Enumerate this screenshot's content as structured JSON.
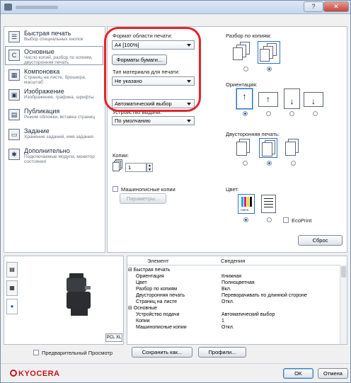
{
  "nav": {
    "items": [
      {
        "title": "Быстрая печать",
        "sub": "Выбор специальных кнопок",
        "icon": "quick-print-icon",
        "glyph": "☰"
      },
      {
        "title": "Основные",
        "sub": "Число копий, разбор по копиям, двусторонняя печать",
        "icon": "basic-icon",
        "glyph": "C"
      },
      {
        "title": "Компоновка",
        "sub": "Страниц на листе, брошюра, масштаб",
        "icon": "layout-icon",
        "glyph": "▦"
      },
      {
        "title": "Изображение",
        "sub": "Изображение, графика, шрифты",
        "icon": "image-icon",
        "glyph": "▣"
      },
      {
        "title": "Публикация",
        "sub": "Режим обложки, вставка страниц",
        "icon": "publishing-icon",
        "glyph": "▤"
      },
      {
        "title": "Задание",
        "sub": "Хранение заданий, имя задания",
        "icon": "job-icon",
        "glyph": "▭"
      },
      {
        "title": "Дополнительно",
        "sub": "Подключаемые модули, монитор состояния",
        "icon": "advanced-icon",
        "glyph": "✱"
      }
    ]
  },
  "basic": {
    "print_size_label": "Формат области печати:",
    "print_size_value": "A4 [100%]",
    "paper_sizes_button": "Форматы бумаги...",
    "media_type_label": "Тип материала для печати:",
    "media_type_value": "Не указано",
    "source_value": "Автоматический выбор",
    "output_label": "Устройство выдачи:",
    "output_value": "По умолчанию",
    "copies_label": "Копии:",
    "copies_value": "1",
    "mopy_label": "Машинописные копии",
    "settings_button": "Параметры...",
    "collate_label": "Разбор по копиям:",
    "orientation_label": "Ориентация:",
    "duplex_label": "Двусторонняя печать:",
    "color_label": "Цвет:",
    "ecoprint_label": "EcoPrint",
    "reset_button": "Сброс"
  },
  "summary": {
    "col_item": "Элемент",
    "col_details": "Сведения",
    "rows": [
      {
        "item": "⊟ Быстрая печать",
        "value": "",
        "indent": 0
      },
      {
        "item": "Ориентация",
        "value": "Книжная",
        "indent": 1
      },
      {
        "item": "Цвет",
        "value": "Полноцветная",
        "indent": 1
      },
      {
        "item": "Разбор по копиям",
        "value": "Вкл.",
        "indent": 1
      },
      {
        "item": "Двусторонняя печать",
        "value": "Переворачивать по длинной стороне",
        "indent": 1
      },
      {
        "item": "Страниц на листе",
        "value": "Откл.",
        "indent": 1
      },
      {
        "item": "⊟ Основные",
        "value": "",
        "indent": 0
      },
      {
        "item": "Устройство подачи",
        "value": "Автоматический выбор",
        "indent": 1
      },
      {
        "item": "Копии",
        "value": "1",
        "indent": 1
      },
      {
        "item": "Машинописные копии",
        "value": "Откл.",
        "indent": 1
      }
    ]
  },
  "preview": {
    "pdl": "PCL XL",
    "preview_label": "Предварительный Просмотр"
  },
  "bottom": {
    "save_as_button": "Сохранить как...",
    "profiles_button": "Профили...",
    "ok_button": "OK",
    "cancel_button": "Отмена",
    "logo": "KYOCERA"
  },
  "colors": {
    "highlight": "#e5242b",
    "accent": "#1d5fb3",
    "logo": "#c8141c"
  }
}
